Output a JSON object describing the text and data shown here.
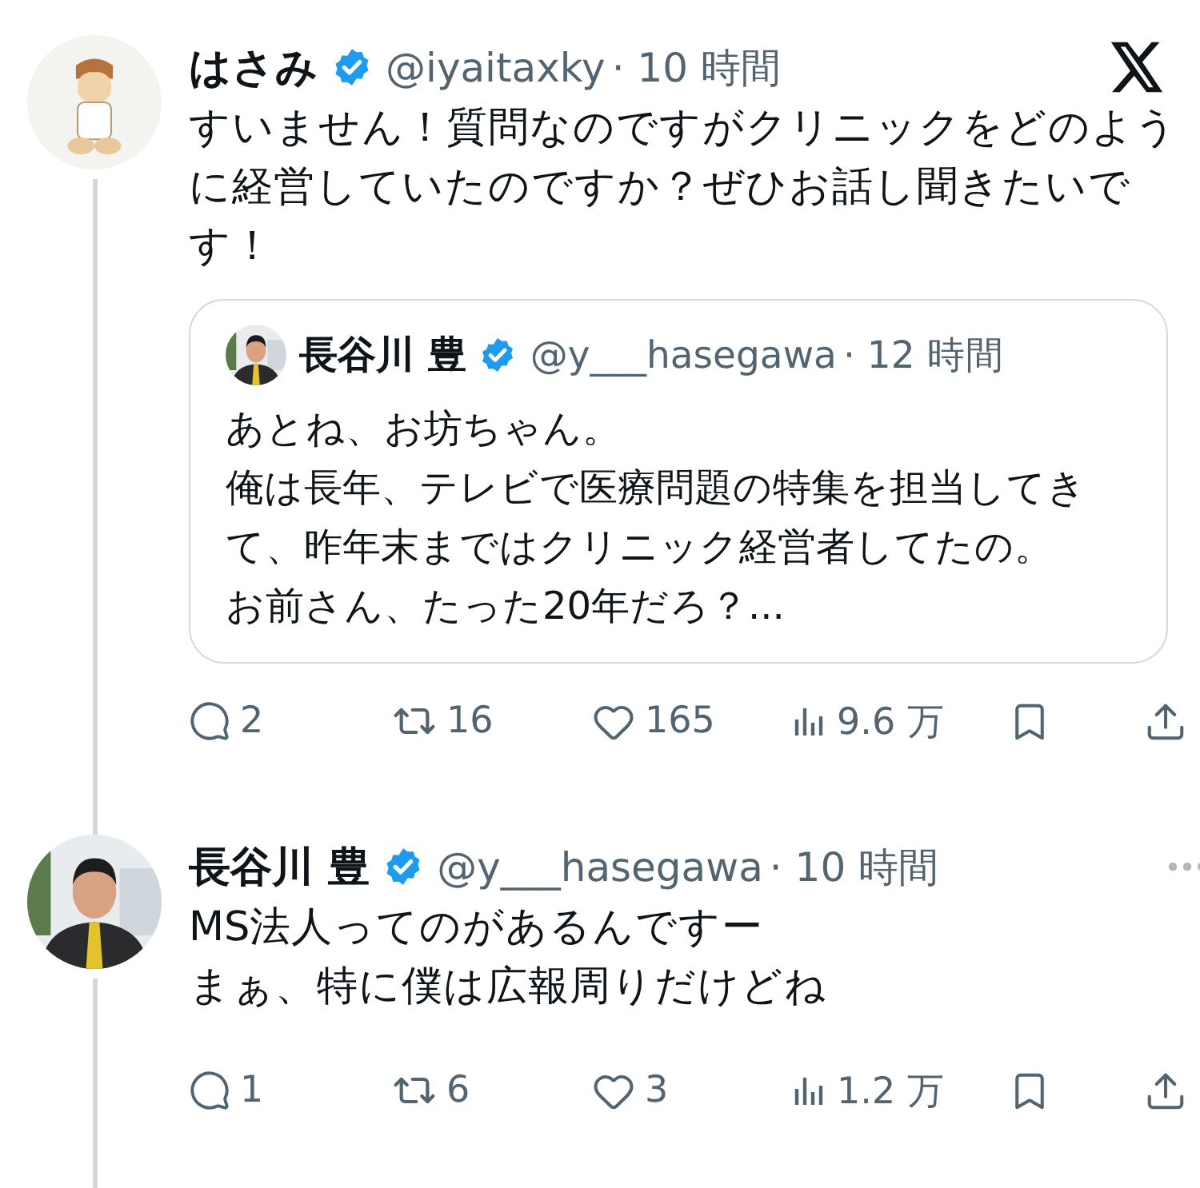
{
  "tweets": [
    {
      "name": "はさみ",
      "verified": true,
      "handle": "@iyaitaxky",
      "time": "· 10 時間",
      "avatar": {
        "kind": "cartoon"
      },
      "paragraphs": [
        "すいません！質問なのですがクリニックをどのように経営していたのですか？ぜひお話し聞きたいです！"
      ],
      "quote": {
        "name": "長谷川 豊",
        "verified": true,
        "handle": "@y___hasegawa",
        "time": "· 12 時間",
        "avatar": {
          "kind": "person"
        },
        "paragraphs": [
          "あとね、お坊ちゃん。",
          "俺は長年、テレビで医療問題の特集を担当してきて、昨年末まではクリニック経営者してたの。",
          "お前さん、たった20年だろ？..."
        ]
      },
      "actions": {
        "replies": "2",
        "reposts": "16",
        "likes": "165",
        "views": "9.6 万"
      }
    },
    {
      "name": "長谷川 豊",
      "verified": true,
      "handle": "@y___hasegawa",
      "time": "· 10 時間",
      "avatar": {
        "kind": "person"
      },
      "paragraphs": [
        "MS法人ってのがあるんですー",
        "まぁ、特に僕は広報周りだけどね"
      ],
      "actions": {
        "replies": "1",
        "reposts": "6",
        "likes": "3",
        "views": "1.2 万"
      }
    }
  ]
}
